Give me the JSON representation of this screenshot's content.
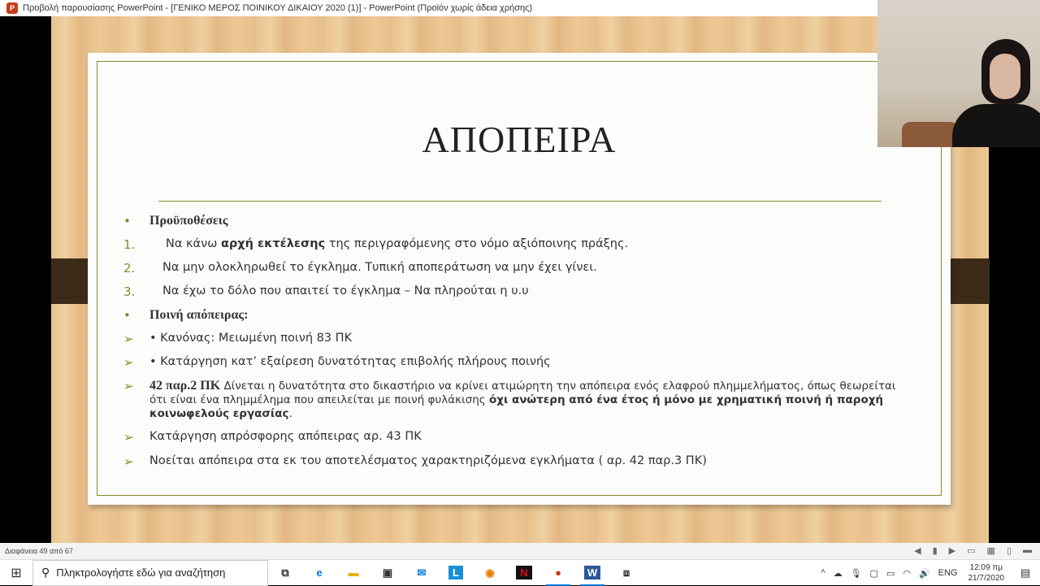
{
  "window": {
    "title": "Προβολή παρουσίασης PowerPoint - [ΓΕΝΙΚΟ ΜΕΡΟΣ ΠΟΙΝΙΚΟΥ ΔΙΚΑΙΟΥ 2020 (1)] - PowerPoint (Προϊόν χωρίς άδεια χρήσης)"
  },
  "slide": {
    "title": "ΑΠΟΠΕΙΡΑ",
    "items": [
      {
        "marker": "•",
        "text": "Προϋποθέσεις",
        "bold": true
      },
      {
        "marker": "1.",
        "pre": "Να κάνω ",
        "bold_part": "αρχή εκτέλεσης",
        "post": " της περιγραφόμενης στο νόμο αξιόποινης πράξης."
      },
      {
        "marker": "2.",
        "text": "Να μην ολοκληρωθεί το έγκλημα. Τυπική αποπεράτωση να μην έχει γίνει."
      },
      {
        "marker": "3.",
        "text": "Να έχω το δόλο που απαιτεί το έγκλημα – Να πληρούται η υ.υ"
      },
      {
        "marker": "•",
        "text": "Ποινή απόπειρας:",
        "bold": true
      },
      {
        "marker": "➢",
        "text": "•  Κανόνας: Μειωμένη  ποινή 83 ΠΚ"
      },
      {
        "marker": "➢",
        "text": "•  Κατάργηση κατ’ εξαίρεση δυνατότητας επιβολής πλήρους ποινής"
      },
      {
        "marker": "➢",
        "lead": "42 παρ.2  ΠΚ",
        "body": " Δίνεται η δυνατότητα στο δικαστήριο  να κρίνει ατιμώρητη την απόπειρα ενός ελαφρού πλημμελήματος, όπως θεωρείται ότι είναι ένα πλημμέλημα που απειλείται με ποινή φυλάκισης ",
        "bold_part": "όχι ανώτερη από ένα έτος ή μόνο με χρηματική ποινή ή παροχή κοινωφελούς εργασίας",
        "post": "."
      },
      {
        "marker": "➢",
        "text": "Κατάργηση απρόσφορης απόπειρας αρ. 43 ΠΚ"
      },
      {
        "marker": "➢",
        "text": "Νοείται απόπειρα στα εκ του αποτελέσματος χαρακτηριζόμενα εγκλήματα ( αρ. 42 παρ.3 ΠΚ)"
      }
    ]
  },
  "statusbar": {
    "slide_counter": "Διαφάνεια 49 από 67"
  },
  "taskbar": {
    "search_placeholder": "Πληκτρολογήστε εδώ για αναζήτηση",
    "apps": [
      "task-view",
      "edge",
      "file-explorer",
      "store",
      "mail",
      "L",
      "app-orange",
      "netflix",
      "powerpoint",
      "word",
      "snip"
    ],
    "language": "ENG",
    "time": "12:09 πμ",
    "date": "21/7/2020"
  },
  "colors": {
    "accent": "#8a8a2a",
    "wood": "#e8c28e",
    "hinge": "#3d2b1a"
  }
}
